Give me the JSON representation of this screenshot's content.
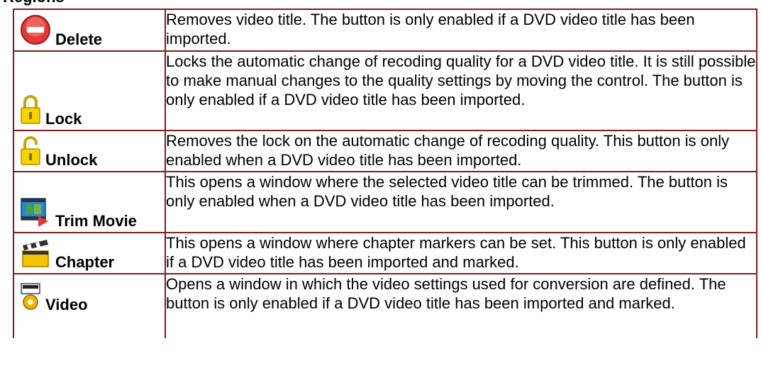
{
  "heading_fragment": "Regions",
  "rows": [
    {
      "icon": "delete-icon",
      "label": "Delete",
      "description": "Removes video title. The button is only enabled if a DVD video title has been imported."
    },
    {
      "icon": "lock-icon",
      "label": "Lock",
      "description": "Locks the automatic change of recoding quality for a DVD video title. It is still possible to make manual changes to the quality settings by moving the control. The button is only enabled if a DVD video title has been imported."
    },
    {
      "icon": "unlock-icon",
      "label": "Unlock",
      "description": "Removes the lock on the automatic change of recoding quality. This button is only enabled when a DVD video title has been imported."
    },
    {
      "icon": "trim-movie-icon",
      "label": "Trim Movie",
      "description": "This opens a window where the selected video title can be trimmed. The button is only enabled when a DVD video title has been imported."
    },
    {
      "icon": "chapter-icon",
      "label": "Chapter",
      "description": "This opens a window where chapter markers can be set. This button is only enabled if a DVD video title has been imported and marked."
    },
    {
      "icon": "video-settings-icon",
      "label": "Video",
      "description": "Opens a window in which the video settings used for conversion are defined. The button is only enabled if a DVD video title has been imported and marked."
    }
  ]
}
